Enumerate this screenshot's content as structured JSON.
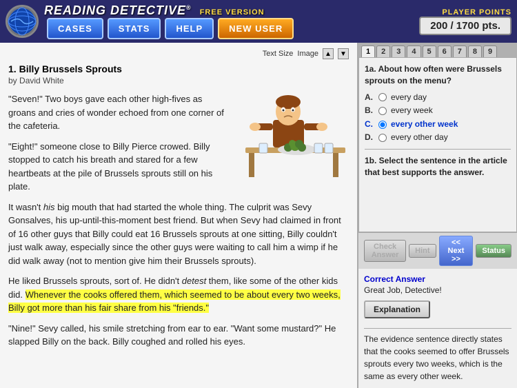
{
  "header": {
    "logo_title": "READING DETECTIVE",
    "logo_reg": "®",
    "free_version": "FREE VERSION",
    "nav": [
      "CASES",
      "STATS",
      "HELP",
      "NEW USER"
    ],
    "player_points_label": "PLAYER POINTS",
    "player_points_value": "200 / 1700 pts."
  },
  "toolbar": {
    "text_size_label": "Text Size",
    "image_label": "Image",
    "up_arrow": "▲",
    "down_arrow": "▼"
  },
  "article": {
    "number": "1.",
    "title": "Billy Brussels Sprouts",
    "author_prefix": "by",
    "author": "David White",
    "paragraphs": [
      "\"Seven!\" Two boys gave each other high-fives as groans and cries of wonder echoed from one corner of the cafeteria.",
      "\"Eight!\" someone close to Billy Pierce crowed. Billy stopped to catch his breath and stared for a few heartbeats at the pile of Brussels sprouts still on his plate.",
      "It wasn't his big mouth that had started the whole thing. The culprit was Sevy Gonsalves, his up-until-this-moment best friend. But when Sevy had claimed in front of 16 other guys that Billy could eat 16 Brussels sprouts at one sitting, Billy couldn't just walk away, especially since the other guys were waiting to call him a wimp if he did walk away (not to mention give him their Brussels sprouts).",
      "He liked Brussels sprouts, sort of. He didn't detest them, like some of the other kids did.",
      "highlight_sentence",
      "\"Nine!\" Sevy called, his smile stretching from ear to ear. \"Want some mustard?\" He slapped Billy on the back. Billy coughed and rolled his eyes."
    ],
    "highlight_text": "Whenever the cooks offered them, which seemed to be about every two weeks, Billy got more than his fair share from his \"friends.\"",
    "italic_word": "his",
    "italic_word2": "detest"
  },
  "questions": {
    "tabs": [
      "1",
      "2",
      "3",
      "4",
      "5",
      "6",
      "7",
      "8",
      "9"
    ],
    "active_tab": "1",
    "q1a_text": "1a. About how often were Brussels sprouts on the menu?",
    "options_a": [
      {
        "letter": "A.",
        "text": "every day",
        "selected": false
      },
      {
        "letter": "B.",
        "text": "every week",
        "selected": false
      },
      {
        "letter": "C.",
        "text": "every other week",
        "selected": true
      },
      {
        "letter": "D.",
        "text": "every other day",
        "selected": false
      }
    ],
    "q1b_text": "1b. Select the sentence in the article that best supports the answer.",
    "buttons": {
      "check_answer": "Check Answer",
      "hint": "Hint",
      "next": "<< Next >>",
      "status": "Status"
    },
    "correct_label": "Correct Answer",
    "correct_text": "Great Job, Detective!",
    "explanation_btn": "Explanation",
    "explanation_text": "The evidence sentence directly states that the cooks seemed to offer Brussels sprouts every two weeks, which is the same as every other week."
  }
}
